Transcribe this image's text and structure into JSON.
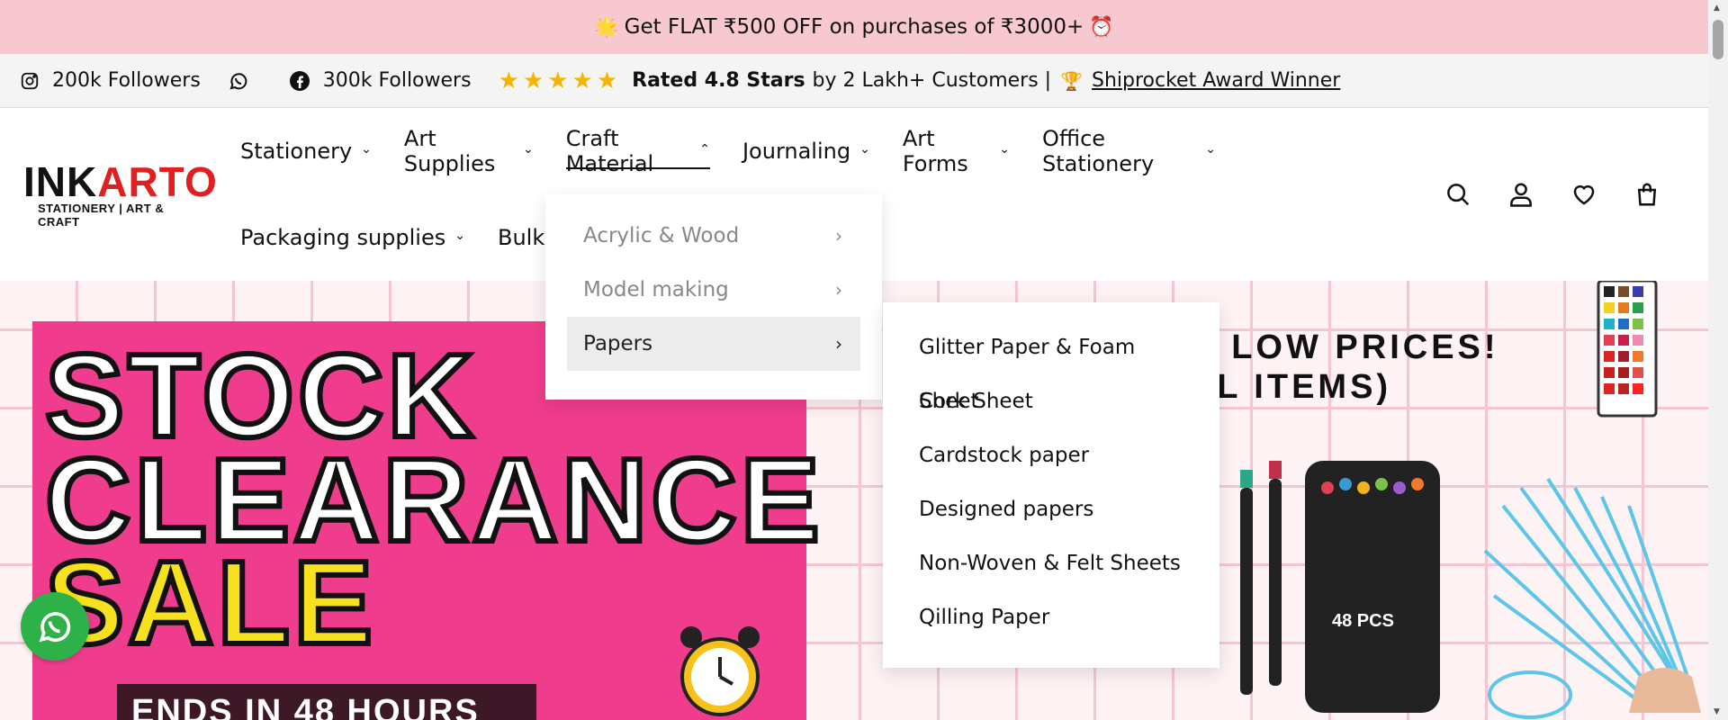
{
  "announcement": {
    "left_emoji": "🌟",
    "text": "Get FLAT ₹500 OFF on purchases of ₹3000+",
    "right_emoji": "⏰"
  },
  "social": {
    "instagram_followers": "200k Followers",
    "facebook_followers": "300k Followers",
    "rating_bold": "Rated 4.8 Stars",
    "rating_rest": "by 2 Lakh+ Customers |",
    "trophy": "🏆",
    "award_link": "Shiprocket Award Winner",
    "star_color": "#f4b400"
  },
  "logo": {
    "ink": "INK",
    "arto": "ARTO",
    "tagline": "STATIONERY | ART & CRAFT"
  },
  "nav": {
    "row1": [
      {
        "label": "Stationery",
        "chevron": "⌄"
      },
      {
        "label": "Art Supplies",
        "chevron": "⌄"
      },
      {
        "label": "Craft Material",
        "chevron": "⌃"
      },
      {
        "label": "Journaling",
        "chevron": "⌄"
      },
      {
        "label": "Art Forms",
        "chevron": "⌄"
      },
      {
        "label": "Office Stationery",
        "chevron": "⌄"
      }
    ],
    "row2": [
      {
        "label": "Packaging supplies",
        "chevron": "⌄"
      },
      {
        "label": "Bulk Or",
        "chevron": ""
      }
    ]
  },
  "dropdown": {
    "items": [
      {
        "label": "Acrylic & Wood",
        "arrow": "›"
      },
      {
        "label": "Model making",
        "arrow": "›"
      },
      {
        "label": "Papers",
        "arrow": "›"
      }
    ],
    "sub_items": [
      "Glitter Paper & Foam Sheet",
      "Cork Sheet",
      "Cardstock paper",
      "Designed papers",
      "Non-Woven & Felt Sheets",
      "Qilling Paper"
    ]
  },
  "banner": {
    "line1": "STOCK",
    "line2": "CLEARANCE",
    "line3": "SALE",
    "ends": "ENDS IN 48 HOURS",
    "promo_line1": "Y LOW PRICES!",
    "promo_line2": "LL ITEMS)",
    "marker_label": "48 PCS",
    "pink": "#f03c8c",
    "yellow": "#f7e11e"
  },
  "icons": [
    "instagram-icon",
    "whatsapp-icon",
    "facebook-icon",
    "search-icon",
    "account-icon",
    "wishlist-icon",
    "cart-icon"
  ]
}
